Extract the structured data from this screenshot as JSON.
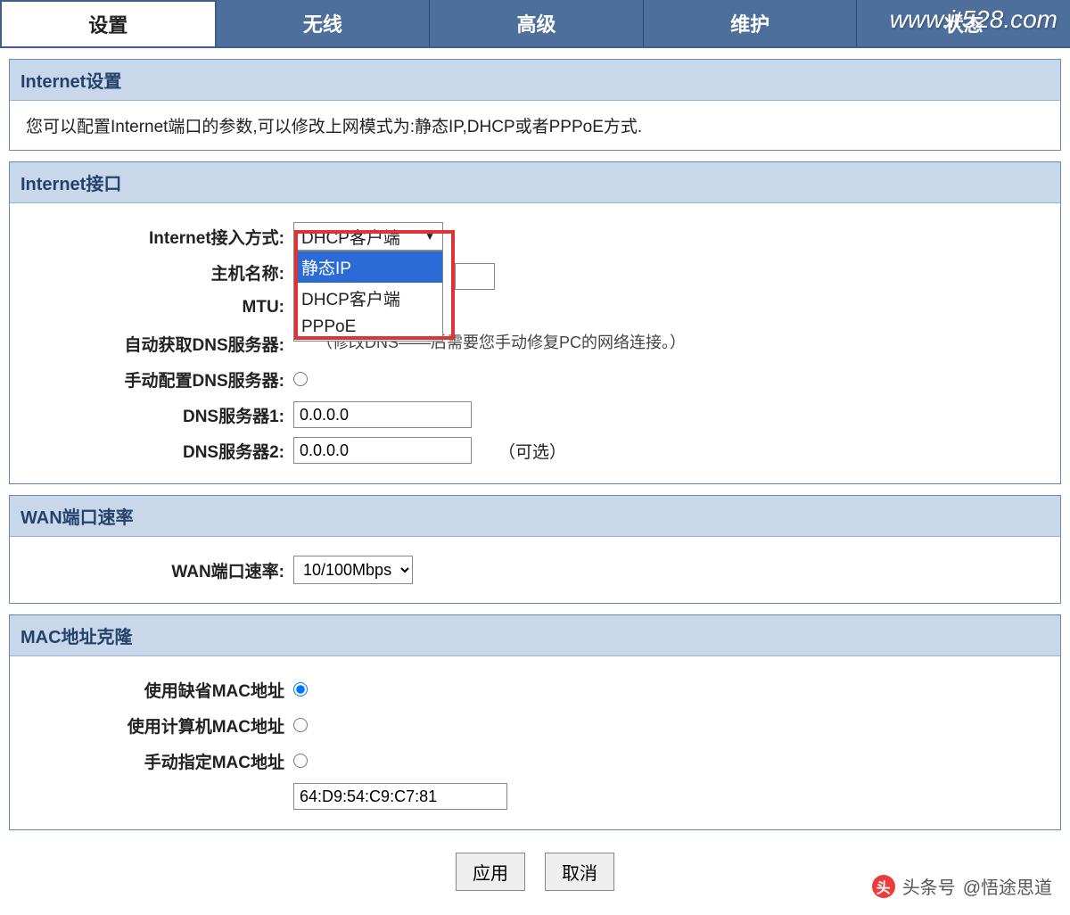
{
  "watermark": {
    "url": "www.it528.com",
    "author_prefix": "头条号",
    "author": "@悟途思道"
  },
  "tabs": {
    "items": [
      "设置",
      "无线",
      "高级",
      "维护",
      "状态"
    ],
    "active_index": 0
  },
  "sections": {
    "internet_settings": {
      "title": "Internet设置",
      "desc": "您可以配置Internet端口的参数,可以修改上网模式为:静态IP,DHCP或者PPPoE方式."
    },
    "internet_interface": {
      "title": "Internet接口",
      "labels": {
        "access_mode": "Internet接入方式:",
        "hostname": "主机名称:",
        "mtu": "MTU:",
        "auto_dns": "自动获取DNS服务器:",
        "manual_dns": "手动配置DNS服务器:",
        "dns1": "DNS服务器1:",
        "dns2": "DNS服务器2:",
        "optional": "（可选）"
      },
      "dropdown": {
        "selected": "DHCP客户端",
        "options": [
          "静态IP",
          "DHCP客户端",
          "PPPoE"
        ],
        "highlight_index": 0
      },
      "dns_hint": "（修改DNS――后需要您手动修复PC的网络连接。）",
      "dns1_value": "0.0.0.0",
      "dns2_value": "0.0.0.0"
    },
    "wan_speed": {
      "title": "WAN端口速率",
      "label": "WAN端口速率:",
      "value": "10/100Mbps"
    },
    "mac_clone": {
      "title": "MAC地址克隆",
      "labels": {
        "default_mac": "使用缺省MAC地址",
        "pc_mac": "使用计算机MAC地址",
        "manual_mac": "手动指定MAC地址"
      },
      "mac_value": "64:D9:54:C9:C7:81"
    }
  },
  "buttons": {
    "apply": "应用",
    "cancel": "取消"
  }
}
